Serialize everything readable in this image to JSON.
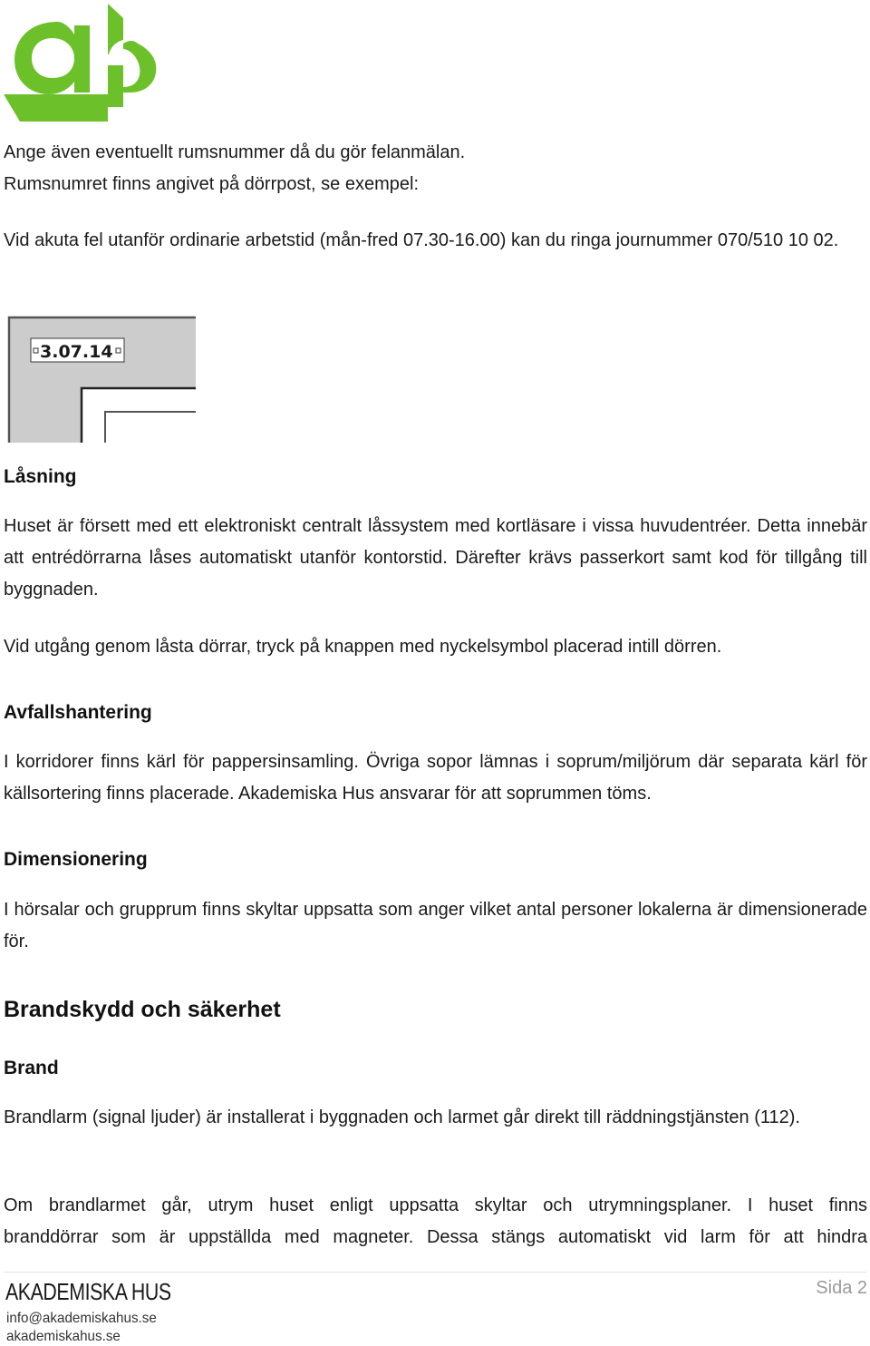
{
  "brand": {
    "logo_icon": "akademiska-hus-ah-logo",
    "logo_color": "#6cc12a"
  },
  "intro": {
    "line1": "Ange även eventuellt rumsnummer då du gör felanmälan.",
    "line2": "Rumsnumret finns angivet på dörrpost, se exempel:",
    "emergency": "Vid akuta fel utanför ordinarie arbetstid (mån-fred 07.30-16.00) kan du ringa journummer 070/510 10 02."
  },
  "door_example": {
    "room_number": "3.07.14",
    "fill_color": "#cccccc"
  },
  "sections": {
    "lasning": {
      "heading": "Låsning",
      "para1": "Huset är försett med ett elektroniskt centralt låssystem med kortläsare i vissa huvudentréer. Detta innebär att entrédörrarna låses automatiskt utanför kontorstid. Därefter krävs passerkort samt kod för tillgång till byggnaden.",
      "para2": "Vid utgång genom låsta dörrar, tryck på knappen med nyckelsymbol placerad intill dörren."
    },
    "avfall": {
      "heading": "Avfallshantering",
      "para1": "I korridorer finns kärl för pappersinsamling. Övriga sopor lämnas i soprum/miljörum där separata kärl för källsortering finns placerade. Akademiska Hus ansvarar för att soprummen töms."
    },
    "dimension": {
      "heading": "Dimensionering",
      "para1": "I hörsalar och grupprum finns skyltar uppsatta som anger vilket antal personer lokalerna är dimensionerade för."
    },
    "brandskydd": {
      "heading": "Brandskydd och säkerhet",
      "subheading": "Brand",
      "para1": "Brandlarm (signal ljuder) är installerat i byggnaden och larmet går direkt till räddningstjänsten (112).",
      "para2_line1": "Om brandlarmet går, utrym huset enligt uppsatta skyltar och utrymningsplaner. I huset finns",
      "para2_line2": "branddörrar som är uppställda med magneter. Dessa stängs automatiskt vid larm för att hindra"
    }
  },
  "footer": {
    "brand": "AKADEMISKA HUS",
    "email": "info@akademiskahus.se",
    "website": "akademiskahus.se",
    "page_label": "Sida 2"
  }
}
